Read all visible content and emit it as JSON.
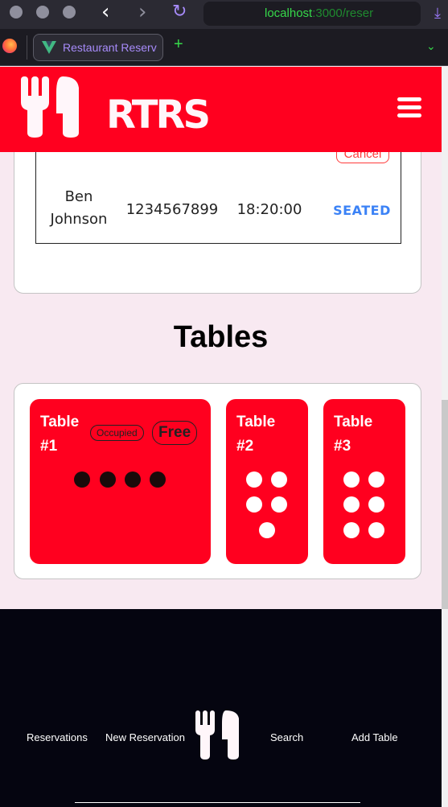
{
  "browser": {
    "url_host": "localhost",
    "url_rest": ":3000/reser",
    "tab_title": "Restaurant Reserv",
    "icons": [
      "back-icon",
      "forward-icon",
      "reload-icon",
      "download-icon",
      "firefox-icon",
      "vue-icon",
      "new-tab-icon",
      "list-tabs-icon"
    ]
  },
  "header": {
    "logo_text": "RTRS",
    "accent_color": "#ff001f"
  },
  "reservations": {
    "cancel_label": "Cancel",
    "row": {
      "name": "Ben Johnson",
      "phone": "1234567899",
      "time": "18:20:00",
      "status": "SEATED"
    }
  },
  "tables": {
    "heading": "Tables",
    "occupied_label": "Occupied",
    "free_label": "Free",
    "items": [
      {
        "title": "Table #1",
        "seats": 4,
        "seat_color": "black"
      },
      {
        "title": "Table #2",
        "seats": 5,
        "seat_color": "white"
      },
      {
        "title": "Table #3",
        "seats": 6,
        "seat_color": "white"
      }
    ]
  },
  "footer": {
    "links": [
      "Reservations",
      "New Reservation",
      "Search",
      "Add Table"
    ]
  }
}
